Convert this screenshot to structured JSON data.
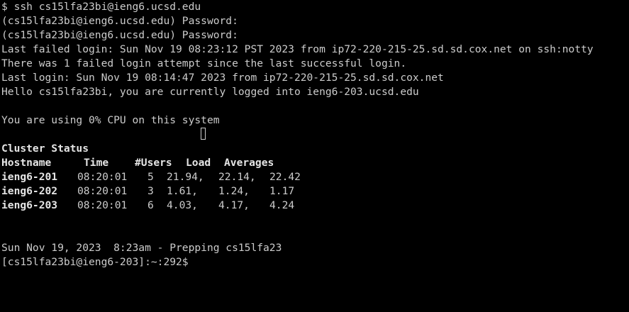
{
  "terminal": {
    "lines": [
      "$ ssh cs15lfa23bi@ieng6.ucsd.edu",
      "(cs15lfa23bi@ieng6.ucsd.edu) Password:",
      "(cs15lfa23bi@ieng6.ucsd.edu) Password:",
      "Last failed login: Sun Nov 19 08:23:12 PST 2023 from ip72-220-215-25.sd.sd.cox.net on ssh:notty",
      "There was 1 failed login attempt since the last successful login.",
      "Last login: Sun Nov 19 08:14:47 2023 from ip72-220-215-25.sd.sd.cox.net",
      "Hello cs15lfa23bi, you are currently logged into ieng6-203.ucsd.edu",
      "",
      "You are using 0% CPU on this system"
    ],
    "cluster": {
      "title": "Cluster Status",
      "headers": {
        "hostname": "Hostname",
        "time": "Time",
        "users": "#Users",
        "load": "Load",
        "averages": "Averages"
      },
      "rows": [
        {
          "host": "ieng6-201",
          "time": "08:20:01",
          "users": "5",
          "a1": "21.94,",
          "a2": "22.14,",
          "a3": "22.42"
        },
        {
          "host": "ieng6-202",
          "time": "08:20:01",
          "users": "3",
          "a1": "1.61,",
          "a2": "1.24,",
          "a3": "1.17"
        },
        {
          "host": "ieng6-203",
          "time": "08:20:01",
          "users": "6",
          "a1": "4.03,",
          "a2": "4.17,",
          "a3": "4.24"
        }
      ]
    },
    "footer": {
      "date_line": "Sun Nov 19, 2023  8:23am - Prepping cs15lfa23",
      "prompt": "[cs15lfa23bi@ieng6-203]:~:292$"
    },
    "colors": {
      "background": "#000000",
      "text": "#cccccc"
    }
  }
}
